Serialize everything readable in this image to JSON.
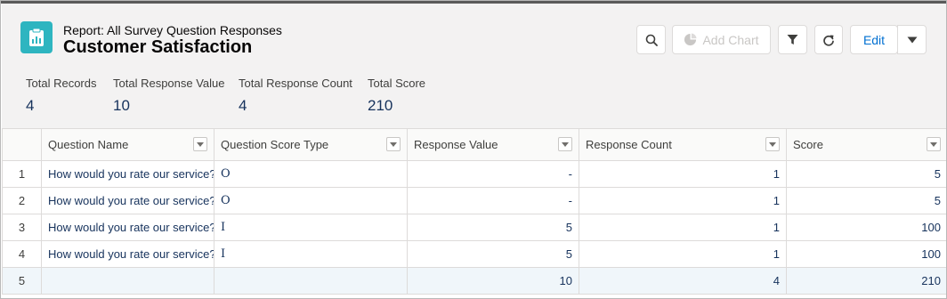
{
  "header": {
    "eyebrow": "Report: All Survey Question Responses",
    "title": "Customer Satisfaction",
    "icon": "report-clipboard-icon",
    "accent": "#2eb5c0"
  },
  "toolbar": {
    "add_chart_label": "Add Chart",
    "edit_label": "Edit"
  },
  "summary": [
    {
      "label": "Total Records",
      "value": "4"
    },
    {
      "label": "Total Response Value",
      "value": "10"
    },
    {
      "label": "Total Response Count",
      "value": "4"
    },
    {
      "label": "Total Score",
      "value": "210"
    }
  ],
  "table": {
    "columns": [
      "Question Name",
      "Question Score Type",
      "Response Value",
      "Response Count",
      "Score"
    ],
    "rows": [
      {
        "num": "1",
        "question": "How would you rate our service?",
        "type": "O",
        "value": "-",
        "count": "1",
        "score": "5"
      },
      {
        "num": "2",
        "question": "How would you rate our service?",
        "type": "O",
        "value": "-",
        "count": "1",
        "score": "5"
      },
      {
        "num": "3",
        "question": "How would you rate our service?",
        "type": "I",
        "value": "5",
        "count": "1",
        "score": "100"
      },
      {
        "num": "4",
        "question": "How would you rate our service?",
        "type": "I",
        "value": "5",
        "count": "1",
        "score": "100"
      }
    ],
    "total": {
      "num": "5",
      "question": "",
      "type": "",
      "value": "10",
      "count": "4",
      "score": "210"
    }
  }
}
